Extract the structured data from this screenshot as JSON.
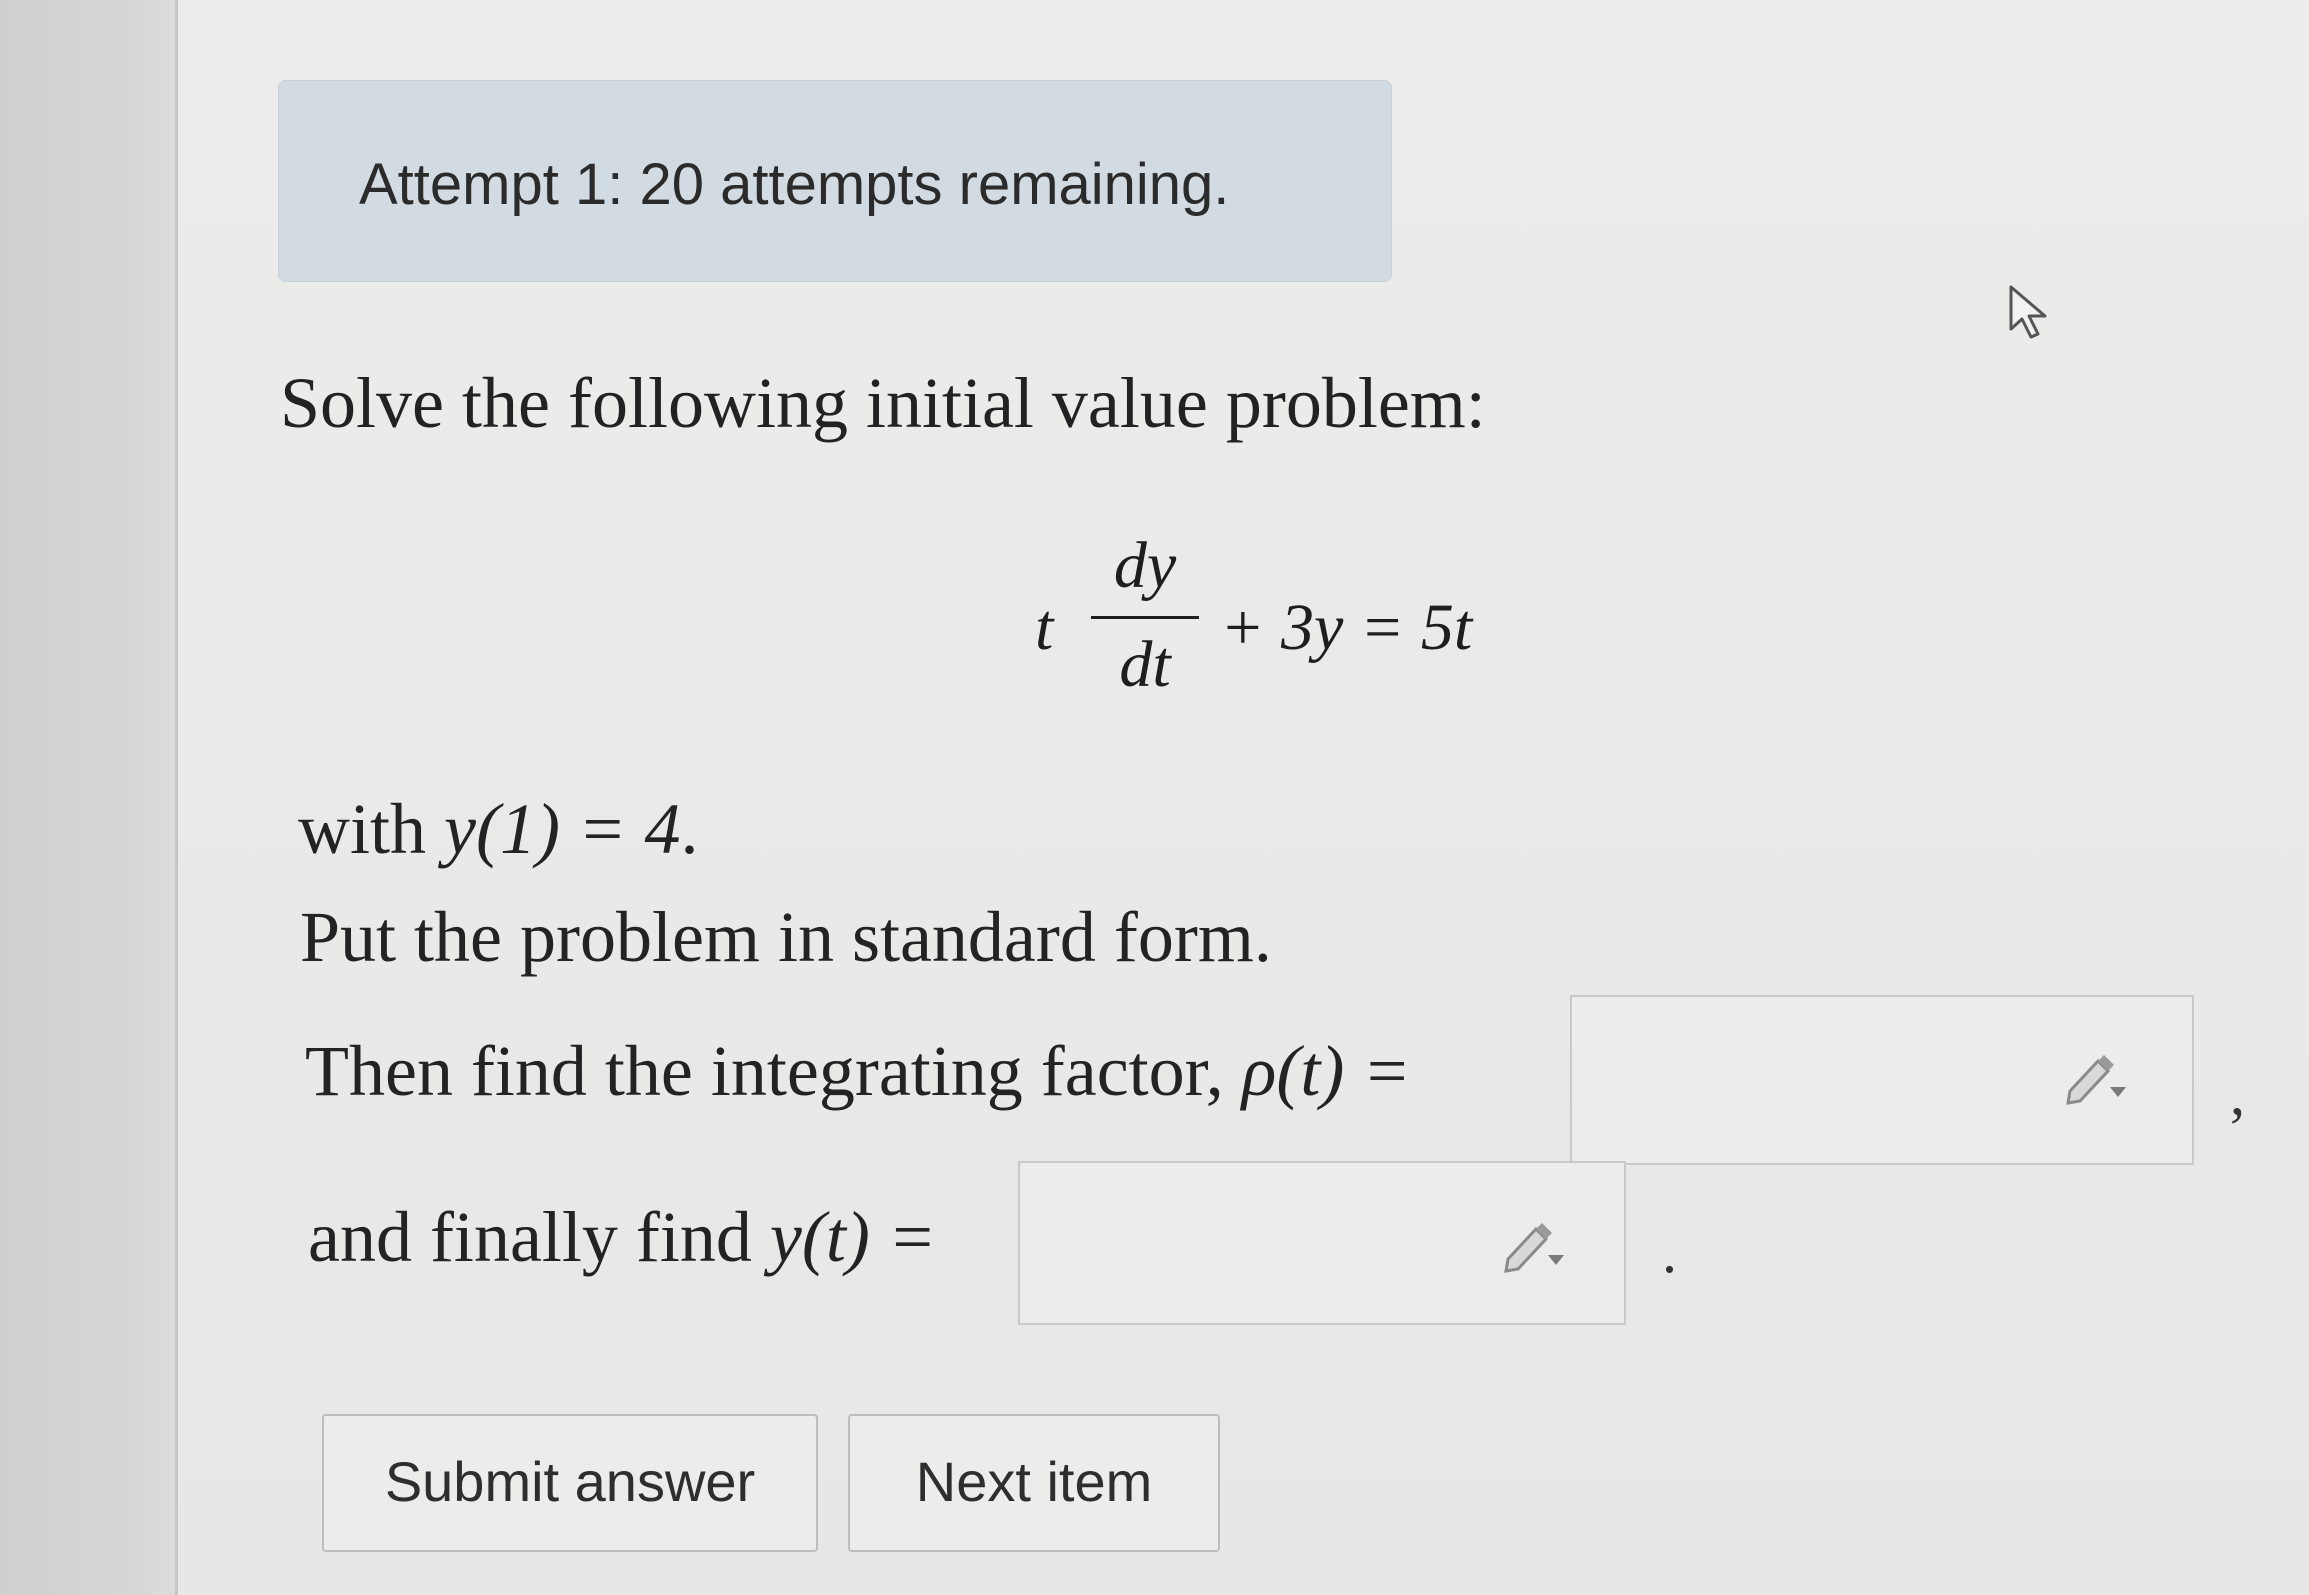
{
  "attempt": {
    "text": "Attempt 1: 20 attempts remaining."
  },
  "problem": {
    "prompt": "Solve the following initial value problem:",
    "equation": {
      "lhs_coef": "t",
      "frac_num": "dy",
      "frac_den": "dt",
      "rest": "+ 3y = 5t"
    },
    "initial_condition": {
      "prefix": "with ",
      "math": "y(1) = 4",
      "suffix": "."
    },
    "standard_form": "Put the problem in standard form.",
    "integrating_factor": {
      "prefix": "Then find the integrating factor, ",
      "math": "ρ(t) =",
      "after_box": ","
    },
    "solution": {
      "prefix": "and finally find ",
      "math": "y(t) =",
      "after_box": "."
    }
  },
  "buttons": {
    "submit_label": "Submit answer",
    "next_label": "Next item"
  },
  "icons": {
    "answer_tool": "pencil-dropdown-icon",
    "cursor": "mouse-pointer-icon"
  }
}
